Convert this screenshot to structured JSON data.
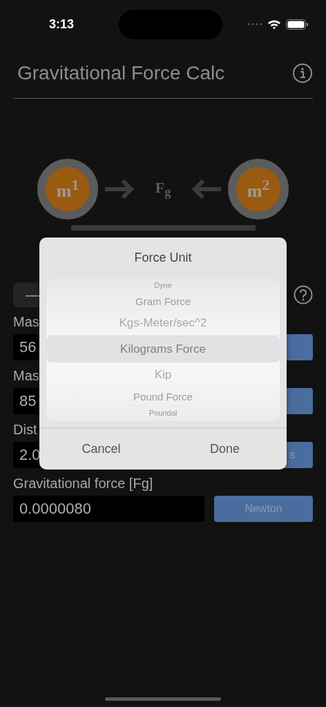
{
  "status_bar": {
    "time": "3:13"
  },
  "header": {
    "title": "Gravitational Force Calc"
  },
  "diagram": {
    "mass_1": "m$^{1}$",
    "force": "F$_{g}$",
    "mass_2": "m$^{2}$"
  },
  "segment": {
    "label": "—"
  },
  "inputs": [
    {
      "label": "Mas",
      "value": "56"
    },
    {
      "label": "Mas",
      "value": "85"
    },
    {
      "label": "Dist",
      "value": "2.0",
      "unit": "s"
    },
    {
      "label": "Gravitational force [Fg]",
      "value": "0.0000080",
      "unit": "Newton"
    }
  ],
  "dialog": {
    "title": "Force Unit",
    "options": [
      {
        "label": "Dyne",
        "selected": false
      },
      {
        "label": "Gram Force",
        "selected": false
      },
      {
        "label": "Kgs-Meter/sec^2",
        "selected": false
      },
      {
        "label": "Kilograms Force",
        "selected": true
      },
      {
        "label": "Kip",
        "selected": false
      },
      {
        "label": "Pound Force",
        "selected": false
      },
      {
        "label": "Poundal",
        "selected": false
      }
    ],
    "buttons": [
      "Cancel",
      "Done"
    ]
  }
}
